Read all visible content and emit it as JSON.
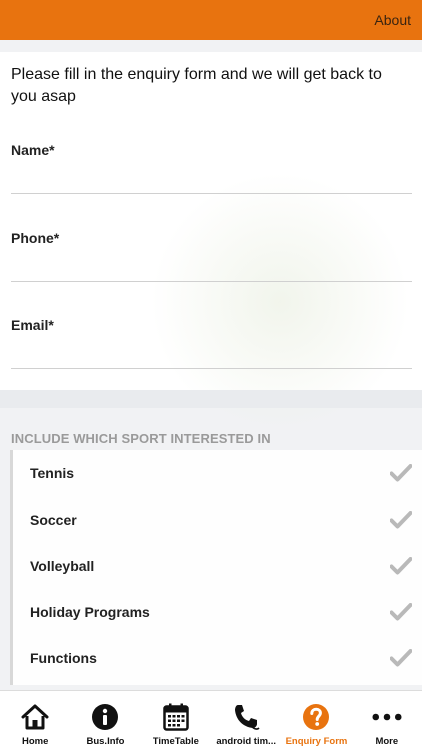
{
  "header": {
    "about_label": "About"
  },
  "form": {
    "intro": "Please fill in the enquiry form and we will get back to you asap",
    "fields": [
      {
        "label": "Name*",
        "value": ""
      },
      {
        "label": "Phone*",
        "value": ""
      },
      {
        "label": "Email*",
        "value": ""
      }
    ]
  },
  "sports": {
    "title": "INCLUDE WHICH SPORT INTERESTED IN",
    "items": [
      {
        "label": "Tennis",
        "icon": "checkmark-icon"
      },
      {
        "label": "Soccer",
        "icon": "checkmark-icon"
      },
      {
        "label": "Volleyball",
        "icon": "checkmark-icon"
      },
      {
        "label": "Holiday Programs",
        "icon": "checkmark-icon"
      },
      {
        "label": "Functions",
        "icon": "checkmark-icon"
      }
    ]
  },
  "tabs": [
    {
      "label": "Home",
      "icon": "home-icon"
    },
    {
      "label": "Bus.Info",
      "icon": "info-icon"
    },
    {
      "label": "TimeTable",
      "icon": "calendar-icon"
    },
    {
      "label": "android tim...",
      "icon": "phone-icon"
    },
    {
      "label": "Enquiry Form",
      "icon": "question-icon",
      "active": true
    },
    {
      "label": "More",
      "icon": "more-dots-icon"
    }
  ],
  "colors": {
    "accent": "#e8730f",
    "check": "#b9b9b9"
  }
}
